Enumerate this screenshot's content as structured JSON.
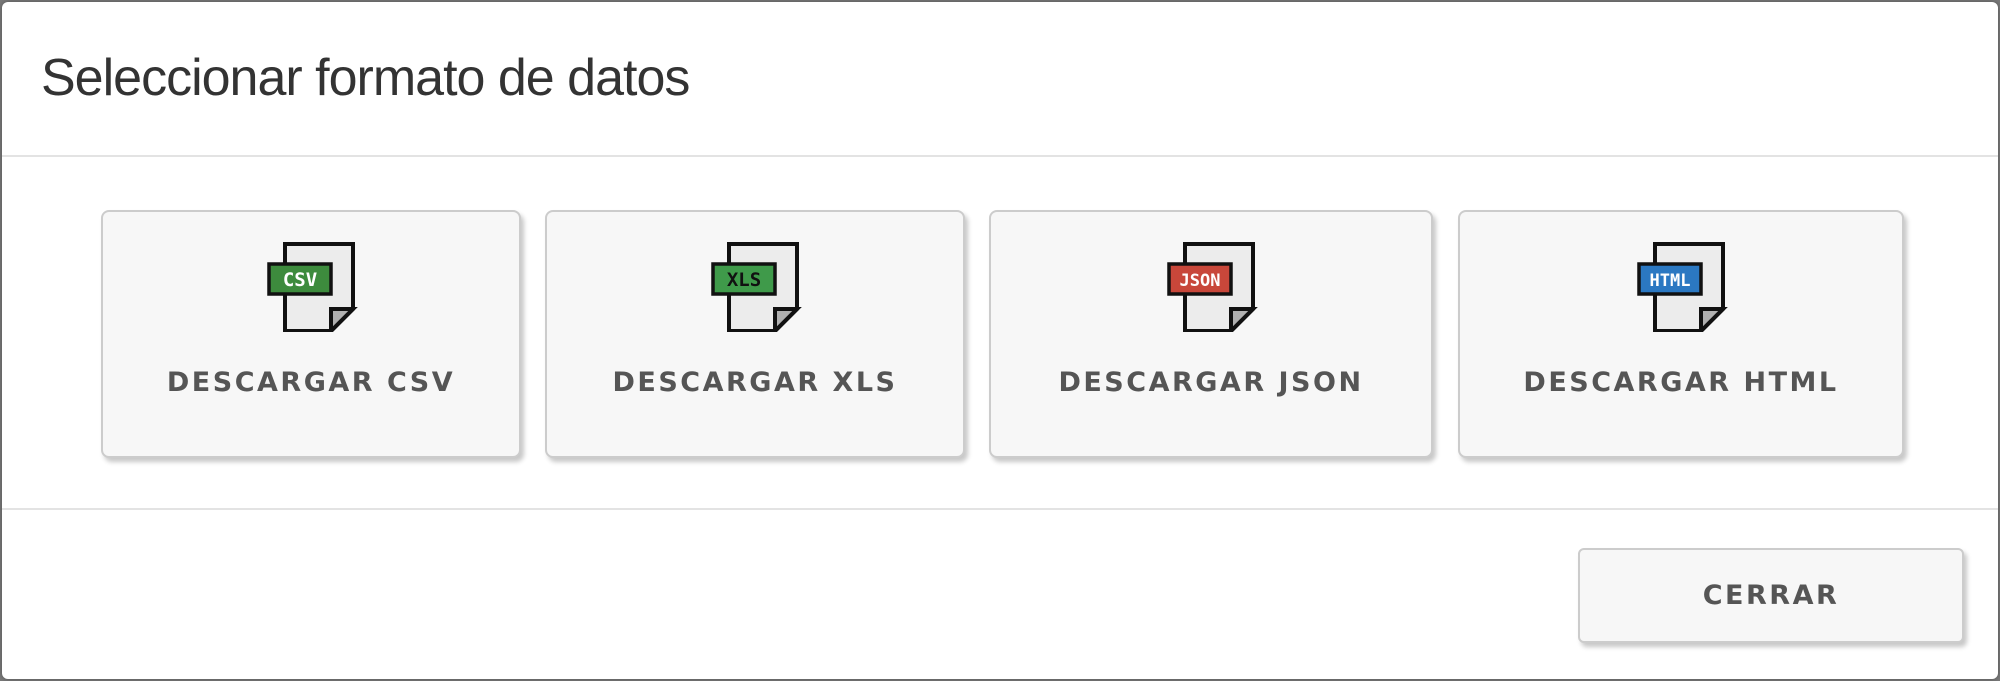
{
  "dialog": {
    "title": "Seleccionar formato de datos"
  },
  "formats": [
    {
      "label": "DESCARGAR CSV",
      "badge": "CSV",
      "badge_color": "#3d8b3d",
      "icon": "csv-file-icon"
    },
    {
      "label": "DESCARGAR XLS",
      "badge": "XLS",
      "badge_color": "#3f9a4a",
      "icon": "xls-file-icon"
    },
    {
      "label": "DESCARGAR JSON",
      "badge": "JSON",
      "badge_color": "#c8473a",
      "icon": "json-file-icon"
    },
    {
      "label": "DESCARGAR HTML",
      "badge": "HTML",
      "badge_color": "#2b78c2",
      "icon": "html-file-icon"
    }
  ],
  "footer": {
    "close_label": "CERRAR"
  }
}
